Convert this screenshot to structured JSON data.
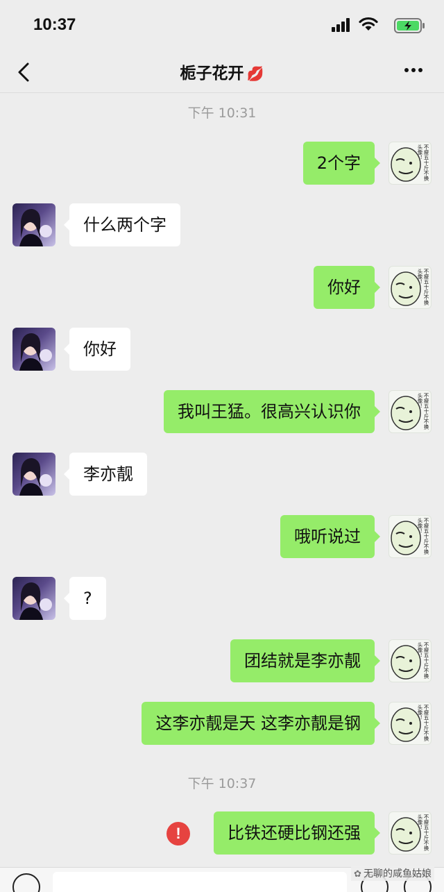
{
  "status_bar": {
    "time": "10:37",
    "icons": [
      "signal-icon",
      "wifi-icon",
      "battery-charging-icon"
    ]
  },
  "header": {
    "title": "栀子花开",
    "title_emoji": "💋",
    "back_icon": "chevron-left-icon",
    "more_icon": "more-dots-icon"
  },
  "messages": [
    {
      "type": "timestamp",
      "text": "下午 10:31"
    },
    {
      "type": "message",
      "side": "right",
      "text": "2个字"
    },
    {
      "type": "message",
      "side": "left",
      "text": "什么两个字"
    },
    {
      "type": "message",
      "side": "right",
      "text": "你好"
    },
    {
      "type": "message",
      "side": "left",
      "text": "你好"
    },
    {
      "type": "message",
      "side": "right",
      "text": "我叫王猛。很高兴认识你"
    },
    {
      "type": "message",
      "side": "left",
      "text": "李亦靓"
    },
    {
      "type": "message",
      "side": "right",
      "text": "哦听说过"
    },
    {
      "type": "message",
      "side": "left",
      "text": "?"
    },
    {
      "type": "message",
      "side": "right",
      "text": "团结就是李亦靓"
    },
    {
      "type": "message",
      "side": "right",
      "text": "这李亦靓是天 这李亦靓是钢"
    },
    {
      "type": "timestamp",
      "text": "下午 10:37"
    },
    {
      "type": "message",
      "side": "right",
      "text": "比铁还硬比钢还强",
      "failed": true
    }
  ],
  "my_avatar_caption": "不瘦五十斤不换头像！",
  "error_mark": "!",
  "watermark": "无聊的咸鱼姑娘",
  "colors": {
    "background": "#ededed",
    "sent_bubble": "#95ec69",
    "received_bubble": "#ffffff",
    "error": "#e64340",
    "timestamp": "#9a9a9a"
  }
}
